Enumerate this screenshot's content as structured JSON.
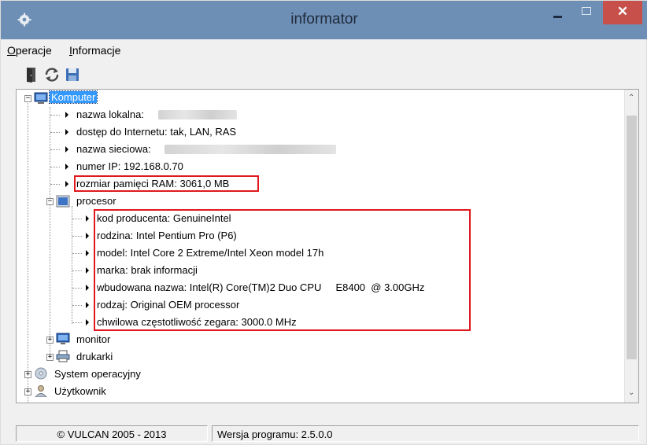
{
  "window": {
    "title": "informator",
    "close_glyph": "✕"
  },
  "menu": {
    "items": [
      {
        "accel": "O",
        "rest": "peracje"
      },
      {
        "accel": "I",
        "rest": "nformacje"
      }
    ]
  },
  "toolbar": {
    "icons": [
      "exit-door-icon",
      "refresh-icon",
      "save-icon"
    ]
  },
  "tree": {
    "root": {
      "label": "Komputer",
      "icon": "computer-icon"
    },
    "computer_items": [
      {
        "label": "nazwa lokalna:",
        "blurred": true
      },
      {
        "label": "dostęp do Internetu: tak, LAN, RAS",
        "blurred": false
      },
      {
        "label": "nazwa sieciowa:",
        "blurred": true
      },
      {
        "label": "numer IP: 192.168.0.70",
        "blurred": false
      },
      {
        "label": "rozmiar pamięci RAM: 3061,0 MB",
        "blurred": false
      }
    ],
    "processor": {
      "label": "procesor",
      "icon": "processor-icon",
      "items": [
        "kod producenta: GenuineIntel",
        "rodzina: Intel Pentium Pro (P6)",
        "model: Intel Core 2 Extreme/Intel Xeon model 17h",
        "marka: brak informacji",
        "wbudowana nazwa: Intel(R) Core(TM)2 Duo CPU     E8400  @ 3.00GHz",
        "rodzaj: Original OEM processor",
        "chwilowa częstotliwość zegara: 3000.0 MHz"
      ]
    },
    "subnodes": [
      {
        "label": "monitor",
        "icon": "monitor-icon"
      },
      {
        "label": "drukarki",
        "icon": "printer-icon"
      }
    ],
    "top_nodes": [
      {
        "label": "System operacyjny",
        "icon": "cd-disc-icon"
      },
      {
        "label": "Użytkownik",
        "icon": "user-icon"
      }
    ],
    "expander_collapsed": "+",
    "expander_expanded": "−"
  },
  "status": {
    "copyright": "© VULCAN 2005 - 2013",
    "version": "Wersja programu: 2.5.0.0"
  },
  "colors": {
    "titlebar": "#6d8fb6",
    "close": "#c7504a",
    "highlight": "#e0191d",
    "selection": "#3399ff"
  }
}
